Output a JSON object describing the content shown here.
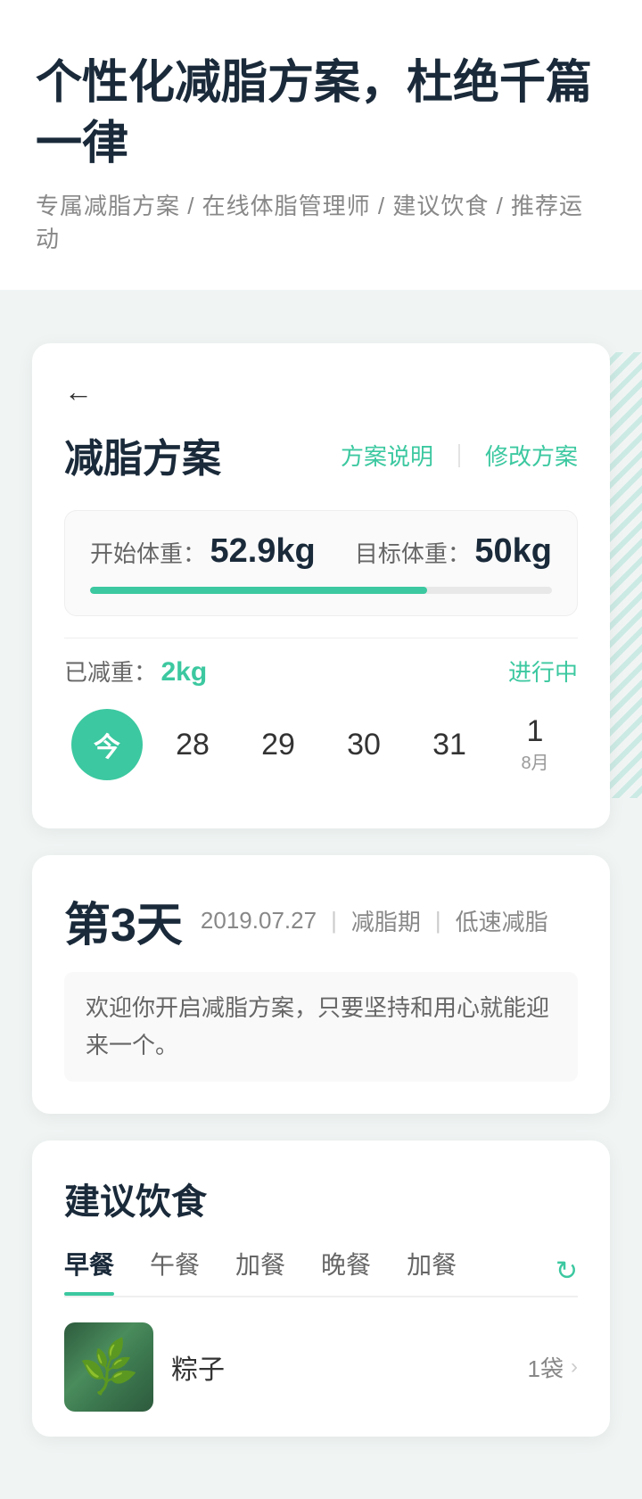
{
  "header": {
    "main_title": "个性化减脂方案，杜绝千篇一律",
    "sub_title": "专属减脂方案 / 在线体脂管理师 / 建议饮食 / 推荐运动"
  },
  "plan": {
    "back_icon": "←",
    "title": "减脂方案",
    "action_explain": "方案说明",
    "action_divider": "｜",
    "action_modify": "修改方案",
    "start_label": "开始体重：",
    "start_value": "52.9kg",
    "target_label": "目标体重：",
    "target_value": "50kg",
    "progress_percent": 73,
    "loss_label": "已减重：",
    "loss_value": "2kg",
    "status": "进行中"
  },
  "calendar": {
    "today_label": "今",
    "days": [
      "28",
      "29",
      "30",
      "31"
    ],
    "next_day": "1",
    "next_month": "8月"
  },
  "day_info": {
    "day_number": "第3天",
    "date": "2019.07.27",
    "divider1": "｜",
    "period_label": "减脂期",
    "divider2": "｜",
    "type_label": "低速减脂",
    "description": "欢迎你开启减脂方案，只要坚持和用心就能迎来一个。"
  },
  "diet": {
    "title": "建议饮食",
    "tabs": [
      {
        "label": "早餐",
        "active": true
      },
      {
        "label": "午餐",
        "active": false
      },
      {
        "label": "加餐",
        "active": false
      },
      {
        "label": "晚餐",
        "active": false
      },
      {
        "label": "加餐",
        "active": false
      }
    ],
    "refresh_icon": "↻",
    "food_items": [
      {
        "name": "粽子",
        "amount": "1袋",
        "has_arrow": true
      }
    ]
  },
  "colors": {
    "primary": "#3cc8a0",
    "text_dark": "#1a2a3a",
    "text_gray": "#888",
    "text_medium": "#666"
  }
}
